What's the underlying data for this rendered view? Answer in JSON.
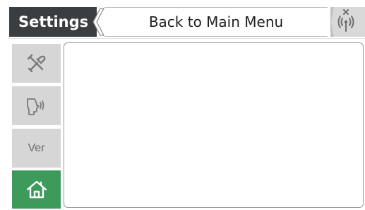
{
  "header": {
    "title": "Settings",
    "back_label": "Back to Main Menu",
    "signal_icon": "antenna-disconnected-icon"
  },
  "sidebar": {
    "items": [
      {
        "icon": "tools-icon",
        "label": ""
      },
      {
        "icon": "voice-icon",
        "label": ""
      },
      {
        "icon": "",
        "label": "Ver"
      },
      {
        "icon": "home-icon",
        "label": "",
        "active": true
      }
    ]
  },
  "colors": {
    "header_bg": "#3b3e41",
    "sidebar_bg": "#d6d6d6",
    "active_bg": "#3d9a5b"
  }
}
